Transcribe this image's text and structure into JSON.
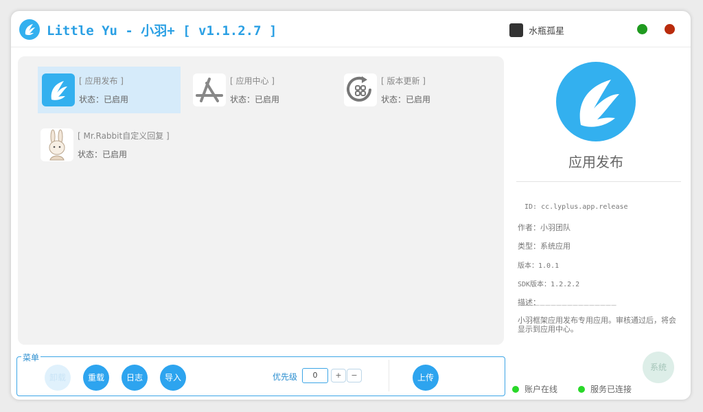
{
  "window": {
    "title": "Little Yu - 小羽+ [ v1.1.2.7 ]",
    "user_name": "水瓶孤星"
  },
  "apps": [
    {
      "name": "[ 应用发布 ]",
      "status": "状态：已启用",
      "icon": "release-logo-icon",
      "selected": true
    },
    {
      "name": "[ 应用中心 ]",
      "status": "状态：已启用",
      "icon": "app-store-icon",
      "selected": false
    },
    {
      "name": "[ 版本更新 ]",
      "status": "状态：已启用",
      "icon": "version-update-icon",
      "selected": false
    },
    {
      "name": "[ Mr.Rabbit自定义回复 ]",
      "status": "状态：已启用",
      "icon": "rabbit-avatar-icon",
      "selected": false
    }
  ],
  "detail": {
    "title": "应用发布",
    "id": "ID: cc.lyplus.app.release",
    "author": "作者：小羽团队",
    "type": "类型：系统应用",
    "version": "版本：1.0.1",
    "sdk_version": "SDK版本：1.2.2.2",
    "desc_label": "描述：",
    "desc_rule": "——————————————————",
    "description": "小羽框架应用发布专用应用。审核通过后，将会显示到应用中心。"
  },
  "menu": {
    "legend": "菜单",
    "buttons": {
      "first": "卸载",
      "reload": "重载",
      "log": "日志",
      "import": "导入",
      "upload": "上传"
    },
    "priority_label": "优先级",
    "priority_value": "0",
    "plus": "+",
    "minus": "−"
  },
  "status": {
    "account": "账户在线",
    "service": "服务已连接",
    "system_button": "系统"
  },
  "colors": {
    "accent": "#2ba0e4",
    "close": "#b92b0c",
    "minimize": "#1f9a1f",
    "online": "#29d829"
  }
}
